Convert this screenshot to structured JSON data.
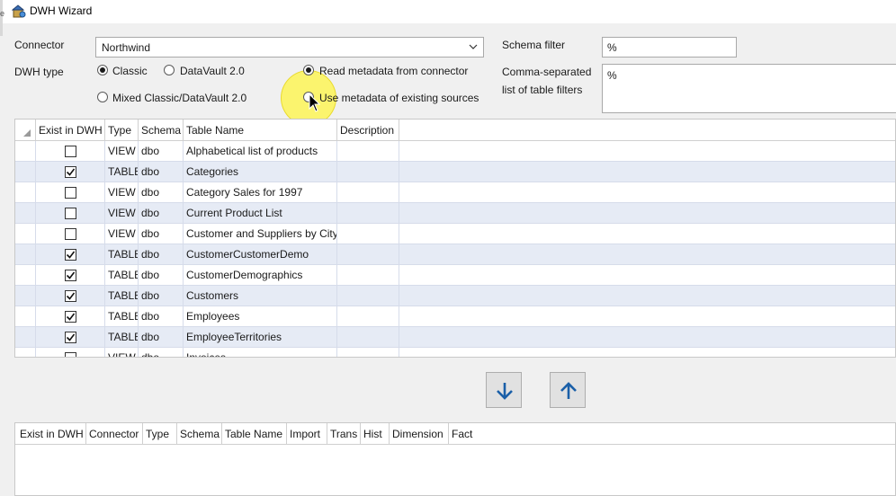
{
  "window": {
    "title": "DWH Wizard",
    "edge_mark": "e"
  },
  "form": {
    "connector_label": "Connector",
    "connector_value": "Northwind",
    "dwh_type_label": "DWH type",
    "dwh_types": [
      {
        "label": "Classic",
        "selected": true
      },
      {
        "label": "DataVault 2.0",
        "selected": false
      },
      {
        "label": "Mixed Classic/DataVault 2.0",
        "selected": false
      }
    ],
    "metadata_options": [
      {
        "label": "Read metadata from connector",
        "selected": true
      },
      {
        "label": "Use metadata of existing sources",
        "selected": false
      }
    ],
    "schema_filter_label": "Schema filter",
    "schema_filter_value": "%",
    "table_filter_label_line1": "Comma-separated",
    "table_filter_label_line2": "list of table filters",
    "table_filter_value": "%"
  },
  "source_grid": {
    "columns": [
      "Exist in DWH",
      "Type",
      "Schema",
      "Table Name",
      "Description"
    ],
    "rows": [
      {
        "exist": false,
        "type": "VIEW",
        "schema": "dbo",
        "name": "Alphabetical list of products",
        "description": ""
      },
      {
        "exist": true,
        "type": "TABLE",
        "schema": "dbo",
        "name": "Categories",
        "description": ""
      },
      {
        "exist": false,
        "type": "VIEW",
        "schema": "dbo",
        "name": "Category Sales for 1997",
        "description": ""
      },
      {
        "exist": false,
        "type": "VIEW",
        "schema": "dbo",
        "name": "Current Product List",
        "description": ""
      },
      {
        "exist": false,
        "type": "VIEW",
        "schema": "dbo",
        "name": "Customer and Suppliers by City",
        "description": ""
      },
      {
        "exist": true,
        "type": "TABLE",
        "schema": "dbo",
        "name": "CustomerCustomerDemo",
        "description": ""
      },
      {
        "exist": true,
        "type": "TABLE",
        "schema": "dbo",
        "name": "CustomerDemographics",
        "description": ""
      },
      {
        "exist": true,
        "type": "TABLE",
        "schema": "dbo",
        "name": "Customers",
        "description": ""
      },
      {
        "exist": true,
        "type": "TABLE",
        "schema": "dbo",
        "name": "Employees",
        "description": ""
      },
      {
        "exist": true,
        "type": "TABLE",
        "schema": "dbo",
        "name": "EmployeeTerritories",
        "description": ""
      },
      {
        "exist": false,
        "type": "VIEW",
        "schema": "dbo",
        "name": "Invoices",
        "description": ""
      }
    ]
  },
  "buttons": {
    "move_down_icon": "arrow-down-icon",
    "move_up_icon": "arrow-up-icon",
    "arrow_color": "#1a5fa8"
  },
  "target_grid": {
    "columns": [
      "Exist in DWH",
      "Connector",
      "Type",
      "Schema",
      "Table Name",
      "Import",
      "Trans",
      "Hist",
      "Dimension",
      "Fact"
    ]
  },
  "colors": {
    "row_alt": "#e6ebf5",
    "highlight": "#fff53c"
  }
}
